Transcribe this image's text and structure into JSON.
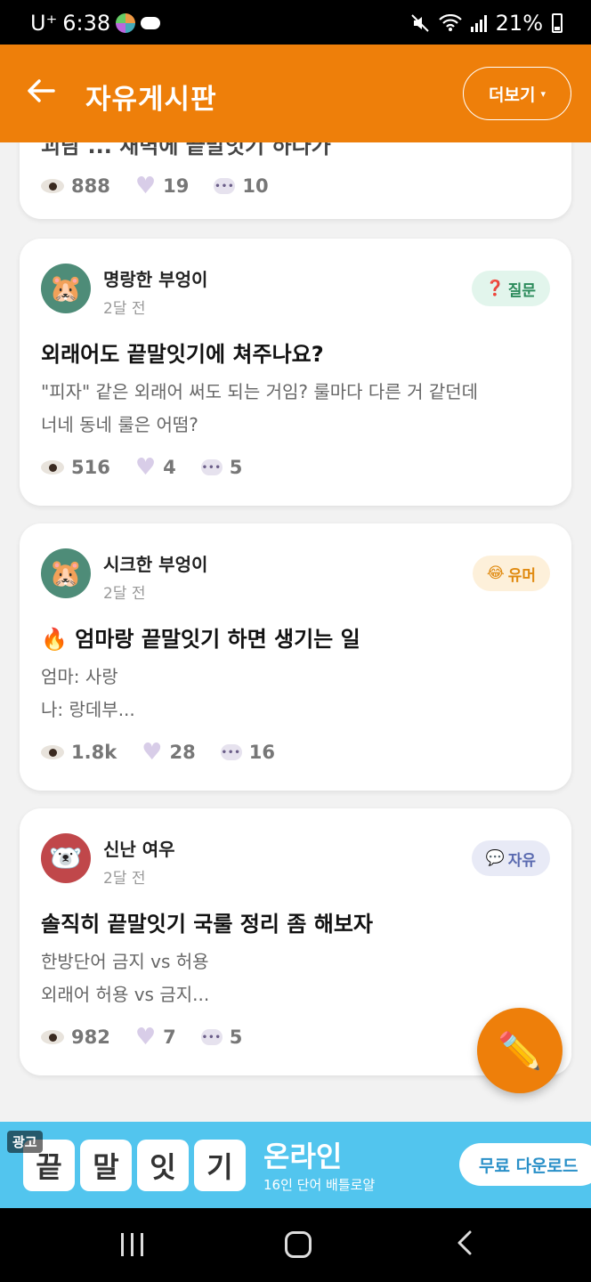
{
  "status_bar": {
    "carrier": "U⁺",
    "time": "6:38",
    "battery": "21%"
  },
  "header": {
    "title": "자유게시판",
    "more_label": "더보기",
    "caret": "▾"
  },
  "posts": [
    {
      "title_partial": "괴담 ... 새벽에 끝말잇기 하다가",
      "stats": {
        "views": "888",
        "likes": "19",
        "comments": "10"
      }
    },
    {
      "author": "명랑한 부엉이",
      "time": "2달 전",
      "avatar": "🐹",
      "avatar_bg": "#4e8c78",
      "tag": {
        "icon": "❓",
        "label": "질문",
        "bg": "#e2f5ec",
        "color": "#2a8a5a"
      },
      "title": "외래어도 끝말잇기에 쳐주나요?",
      "excerpt": [
        "\"피자\" 같은 외래어 써도 되는 거임? 룰마다 다른 거 같던데",
        "너네 동네 룰은 어떰?"
      ],
      "stats": {
        "views": "516",
        "likes": "4",
        "comments": "5"
      }
    },
    {
      "author": "시크한 부엉이",
      "time": "2달 전",
      "avatar": "🐹",
      "avatar_bg": "#4e8c78",
      "tag": {
        "icon": "😂",
        "label": "유머",
        "bg": "#fdf0da",
        "color": "#e08a10"
      },
      "title": "🔥 엄마랑 끝말잇기 하면 생기는 일",
      "excerpt": [
        "엄마: 사랑",
        "나: 랑데부..."
      ],
      "stats": {
        "views": "1.8k",
        "likes": "28",
        "comments": "16"
      }
    },
    {
      "author": "신난 여우",
      "time": "2달 전",
      "avatar": "🐻‍❄️",
      "avatar_bg": "#c0474a",
      "tag": {
        "icon": "💬",
        "label": "자유",
        "bg": "#e8eaf6",
        "color": "#5a6ab0"
      },
      "title": "솔직히 끝말잇기 국룰 정리 좀 해보자",
      "excerpt": [
        "한방단어 금지 vs 허용",
        "외래어 허용 vs 금지..."
      ],
      "stats": {
        "views": "982",
        "likes": "7",
        "comments": "5"
      }
    }
  ],
  "fab": {
    "icon": "✏️"
  },
  "ad": {
    "badge": "광고",
    "tiles": [
      "끝",
      "말",
      "잇",
      "기"
    ],
    "title": "온라인",
    "subtitle": "16인 단어 배틀로얄",
    "cta": "무료 다운로드"
  }
}
